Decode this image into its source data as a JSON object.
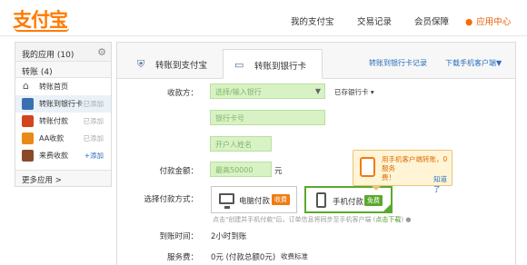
{
  "header": {
    "logo": "支付宝",
    "nav": [
      "我的支付宝",
      "交易记录",
      "会员保障"
    ],
    "app_center": "应用中心"
  },
  "left": {
    "my_apps": "我的应用 (10)",
    "transfer_section": "转账 (4)",
    "items": [
      {
        "label": "转账首页",
        "action": ""
      },
      {
        "label": "转账到银行卡",
        "action": "已添加"
      },
      {
        "label": "转账付款",
        "action": "已添加"
      },
      {
        "label": "AA收款",
        "action": "已添加"
      },
      {
        "label": "来费收款",
        "action": "+添加"
      }
    ],
    "more": "更多应用 >"
  },
  "tabs": {
    "tab1": "转账到支付宝",
    "tab2": "转账到银行卡",
    "record_link": "转账到银行卡记录",
    "download_link": "下载手机客户端▼"
  },
  "form": {
    "recipient_label": "收款方：",
    "bank_placeholder": "选择/输入银行",
    "used_cards": "已存银行卡 ▾",
    "card_placeholder": "银行卡号",
    "name_placeholder": "开户人姓名",
    "amount_label": "付款金额：",
    "amount_placeholder": "最高50000",
    "yuan": "元",
    "method_label": "选择付款方式：",
    "pc_pay": "电脑付款",
    "pc_badge": "收费",
    "mobile_pay": "手机付款",
    "mobile_badge": "免费",
    "hint_text": "点击\"创建并手机付款\"后，订单信息将同步至手机客户端 (",
    "hint_link": "点击下载",
    "hint_end": ") ●",
    "arrival_label": "到账时间：",
    "arrival_value": "2小时到账",
    "fee_label": "服务费：",
    "fee_value": "0元 (付款总额0元)",
    "fee_link": "收费标准"
  },
  "tooltip": {
    "text_line1": "用手机客户端转账，0服务",
    "text_line2": "费！",
    "dismiss": "知道了"
  },
  "colors": {
    "accent": "#ff7a00",
    "input_green": "#d8f2c6",
    "link_blue": "#2a6ebb",
    "mobile_green": "#5aa92e"
  }
}
